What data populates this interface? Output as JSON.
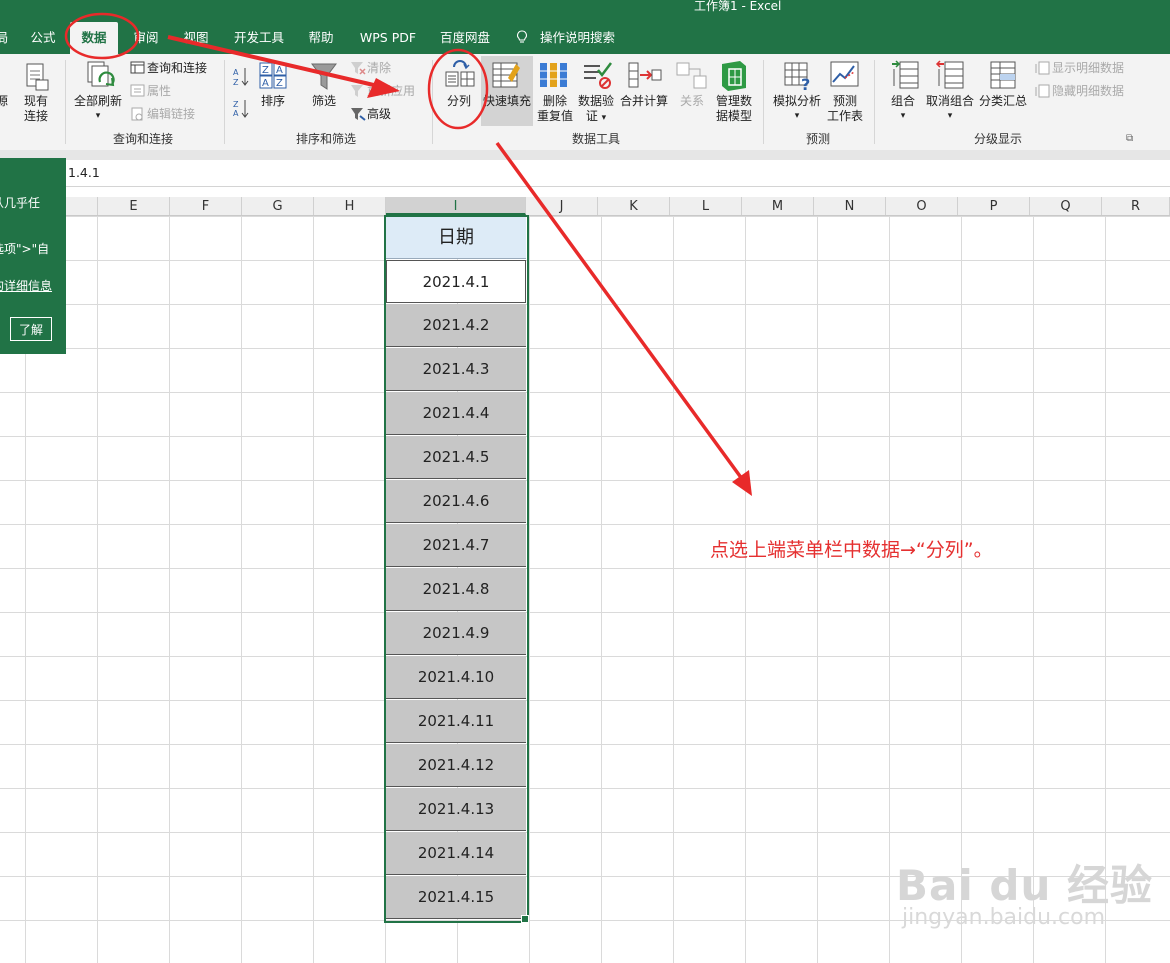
{
  "window": {
    "title": "工作簿1  -  Excel"
  },
  "tabs": [
    {
      "label": "局",
      "active": false
    },
    {
      "label": "公式",
      "active": false
    },
    {
      "label": "数据",
      "active": true
    },
    {
      "label": "审阅",
      "active": false
    },
    {
      "label": "视图",
      "active": false
    },
    {
      "label": "开发工具",
      "active": false
    },
    {
      "label": "帮助",
      "active": false
    },
    {
      "label": "WPS PDF",
      "active": false
    },
    {
      "label": "百度网盘",
      "active": false
    },
    {
      "label": "操作说明搜索",
      "active": false
    }
  ],
  "ribbon": {
    "query": {
      "partial_a": "源",
      "existing_conn": [
        "现有",
        "连接"
      ],
      "refresh_all": "全部刷新",
      "queries_connections": "查询和连接",
      "properties": "属性",
      "edit_links": "编辑链接",
      "group_label": "查询和连接"
    },
    "sort_filter": {
      "sort": "排序",
      "filter": "筛选",
      "clear": "清除",
      "reapply": "重新应用",
      "advanced": "高级",
      "group_label": "排序和筛选"
    },
    "data_tools": {
      "text_to_columns": "分列",
      "flash_fill": "快速填充",
      "remove_duplicates": [
        "删除",
        "重复值"
      ],
      "data_validation": [
        "数据验",
        "证"
      ],
      "consolidate": "合并计算",
      "relationships": "关系",
      "manage_model": [
        "管理数",
        "据模型"
      ],
      "group_label": "数据工具"
    },
    "forecast": {
      "what_if": "模拟分析",
      "forecast_sheet": [
        "预测",
        "工作表"
      ],
      "group_label": "预测"
    },
    "outline": {
      "group": "组合",
      "ungroup": "取消组合",
      "subtotal": "分类汇总",
      "show_detail": "显示明细数据",
      "hide_detail": "隐藏明细数据",
      "group_label": "分级显示"
    }
  },
  "formula_bar": {
    "value": "1.4.1"
  },
  "columns": [
    "E",
    "F",
    "G",
    "H",
    "I",
    "J",
    "K",
    "L",
    "M",
    "N",
    "O",
    "P",
    "Q",
    "R"
  ],
  "sheet": {
    "header": "日期",
    "values": [
      "2021.4.1",
      "2021.4.2",
      "2021.4.3",
      "2021.4.4",
      "2021.4.5",
      "2021.4.6",
      "2021.4.7",
      "2021.4.8",
      "2021.4.9",
      "2021.4.10",
      "2021.4.11",
      "2021.4.12",
      "2021.4.13",
      "2021.4.14",
      "2021.4.15"
    ]
  },
  "popup": {
    "lines": [
      "从几乎任",
      "选项\">\"自",
      "的详细信息"
    ],
    "button": "了解"
  },
  "annotation": "点选上端菜单栏中数据→“分列”。",
  "watermark": {
    "main": "Bai du 经验",
    "sub": "jingyan.baidu.com"
  },
  "colors": {
    "excel_green": "#217346",
    "annotation_red": "#e53030",
    "header_fill": "#ddebf7",
    "selection_fill": "#c6c6c6"
  },
  "icons": [
    "refresh-icon",
    "sort-az-icon",
    "sort-za-icon",
    "filter-funnel-icon",
    "text-to-columns-icon",
    "flash-fill-icon",
    "remove-duplicates-icon",
    "data-validation-icon",
    "consolidate-icon",
    "relationships-icon",
    "manage-model-icon",
    "what-if-icon",
    "forecast-sheet-icon",
    "group-icon",
    "ungroup-icon",
    "subtotal-icon",
    "lightbulb-icon"
  ]
}
